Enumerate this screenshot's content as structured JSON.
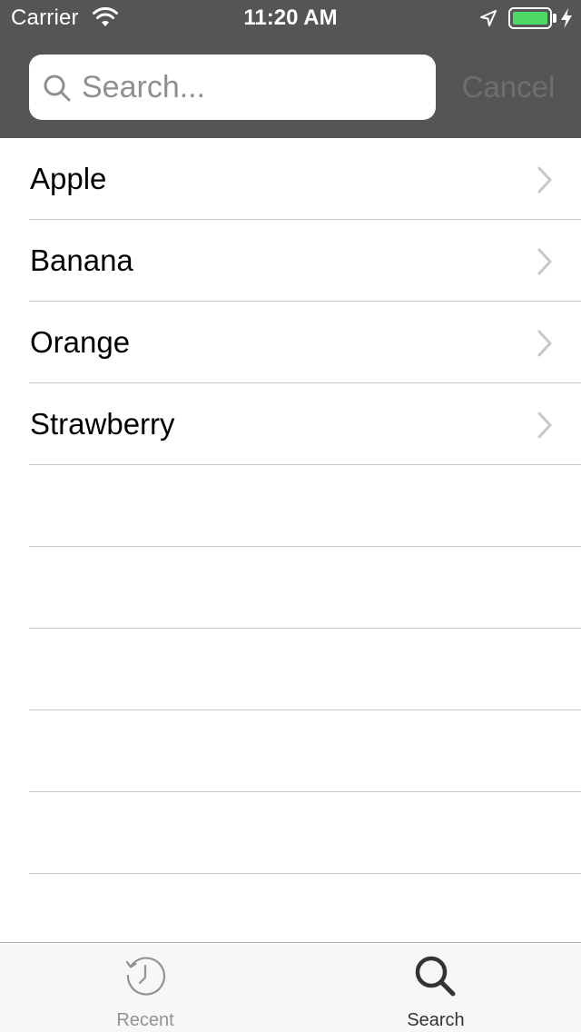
{
  "status_bar": {
    "carrier": "Carrier",
    "time": "11:20 AM",
    "battery_color": "#4cd964",
    "icons": [
      "wifi-icon",
      "location-icon",
      "battery-icon",
      "charging-icon"
    ]
  },
  "search": {
    "placeholder": "Search...",
    "value": "",
    "cancel_label": "Cancel"
  },
  "list": {
    "items": [
      {
        "label": "Apple"
      },
      {
        "label": "Banana"
      },
      {
        "label": "Orange"
      },
      {
        "label": "Strawberry"
      }
    ]
  },
  "tab_bar": {
    "tabs": [
      {
        "label": "Recent",
        "icon": "recent-clock-icon",
        "selected": false
      },
      {
        "label": "Search",
        "icon": "search-icon",
        "selected": true
      }
    ],
    "selected_color": "#333333",
    "unselected_color": "#929292"
  },
  "colors": {
    "header_background": "#555555",
    "cancel_text": "#6e6e6e",
    "separator": "#c8c7cc",
    "chevron": "#c7c7cc"
  }
}
